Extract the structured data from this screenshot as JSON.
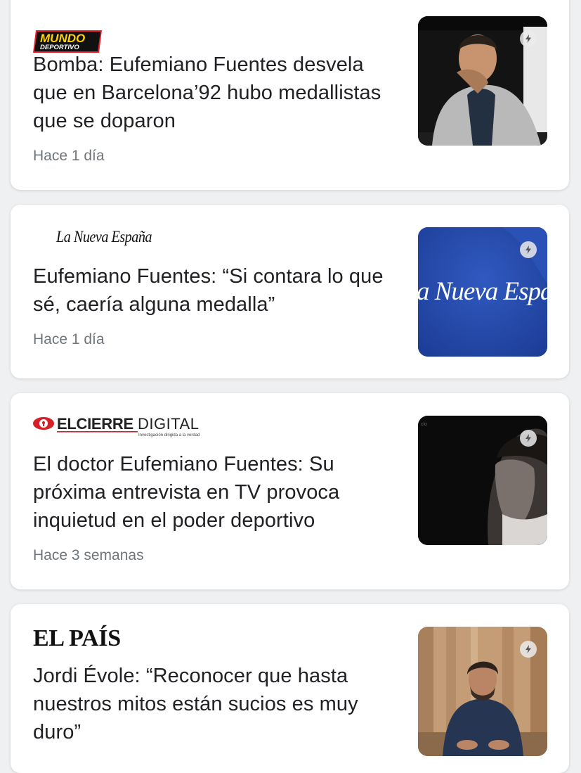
{
  "articles": [
    {
      "source": "MUNDO DEPORTIVO",
      "logo_line1": "MUNDO",
      "logo_line2": "DEPORTIVO",
      "headline": "Bomba: Eufemiano Fuentes desvela que en Barcelona’92 hubo medallistas que se doparon",
      "time": "Hace 1 día",
      "amp_icon": "lightning-bolt-icon"
    },
    {
      "source": "La Nueva España",
      "thumb_text": "a Nueva Espa",
      "headline": "Eufemiano Fuentes: “Si contara lo que sé, caería alguna medalla”",
      "time": "Hace 1 día",
      "amp_icon": "lightning-bolt-icon"
    },
    {
      "source": "ELCIERREDIGITAL",
      "logo_bold": "ELCIERRE",
      "logo_light": "DIGITAL",
      "logo_tagline": "Investigación dirigida a la verdad",
      "headline": "El doctor Eufemiano Fuentes: Su próxima entrevista en TV provoca inquietud en el poder deportivo",
      "time": "Hace 3 semanas",
      "amp_icon": "lightning-bolt-icon"
    },
    {
      "source": "EL PAÍS",
      "headline": "Jordi Évole: “Reconocer que hasta nuestros mitos están sucios es muy duro”",
      "amp_icon": "lightning-bolt-icon"
    }
  ],
  "colors": {
    "mundo_red": "#e3202c",
    "mundo_yellow": "#ffd200",
    "cierre_red": "#d62027",
    "nueva_blue": "#2448a8"
  }
}
